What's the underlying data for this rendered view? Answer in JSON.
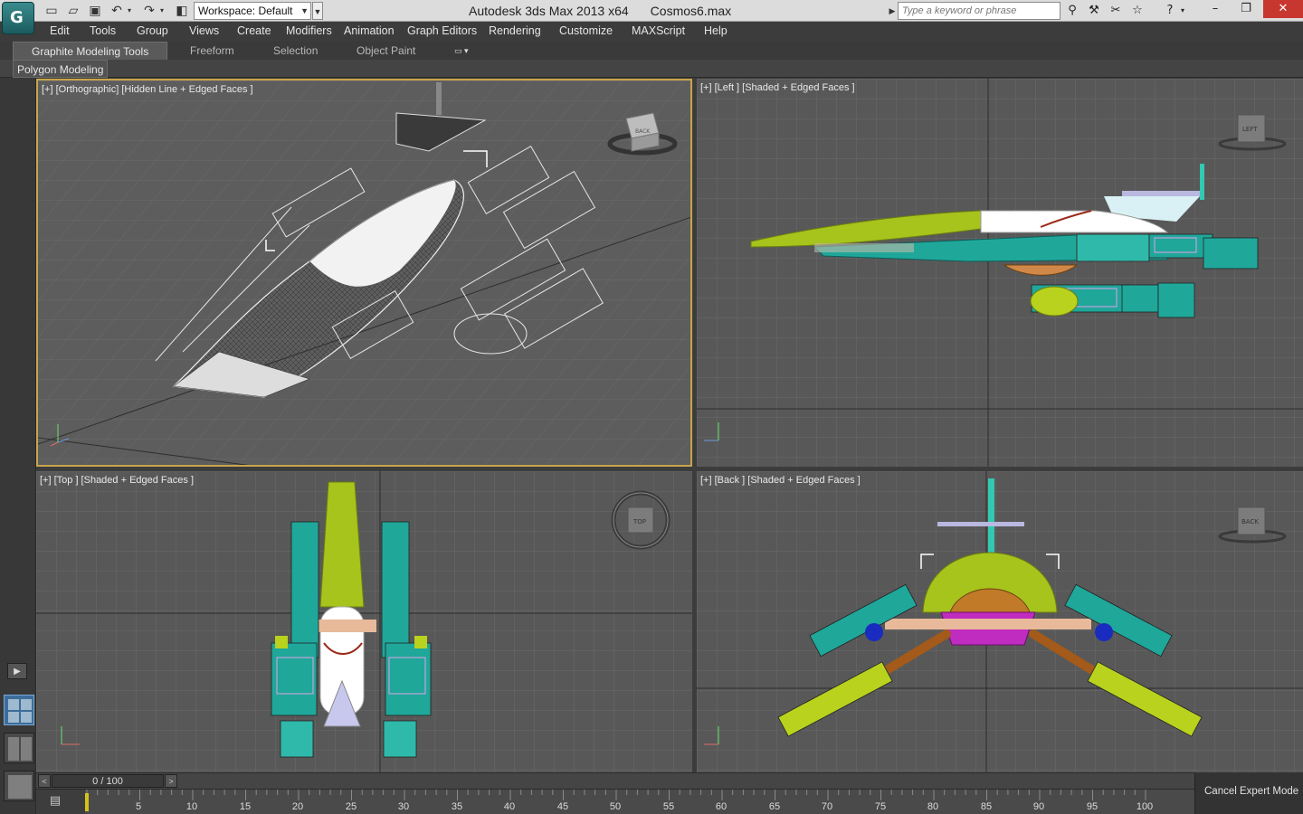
{
  "titlebar": {
    "app_title": "Autodesk 3ds Max  2013 x64",
    "file_name": "Cosmos6.max",
    "workspace_label": "Workspace: Default",
    "search_placeholder": "Type a keyword or phrase"
  },
  "menu": {
    "items": [
      "Edit",
      "Tools",
      "Group",
      "Views",
      "Create",
      "Modifiers",
      "Animation",
      "Graph Editors",
      "Rendering",
      "Customize",
      "MAXScript",
      "Help"
    ]
  },
  "ribbon": {
    "tabs": [
      "Graphite Modeling Tools",
      "Freeform",
      "Selection",
      "Object Paint"
    ],
    "active_panel": "Polygon Modeling"
  },
  "viewports": {
    "perspective": {
      "label": "[+] [Orthographic] [Hidden Line + Edged Faces ]",
      "cube_label": "BACK"
    },
    "left": {
      "label": "[+] [Left ] [Shaded + Edged Faces ]",
      "cube_label": "LEFT"
    },
    "top": {
      "label": "[+] [Top ] [Shaded + Edged Faces ]",
      "cube_label": "TOP"
    },
    "back": {
      "label": "[+] [Back ] [Shaded + Edged Faces ]",
      "cube_label": "BACK"
    }
  },
  "timeline": {
    "frame_display": "0 / 100",
    "ticks": [
      "5",
      "10",
      "15",
      "20",
      "25",
      "30",
      "35",
      "40",
      "45",
      "50",
      "55",
      "60",
      "65",
      "70",
      "75",
      "80",
      "85",
      "90",
      "95",
      "100"
    ]
  },
  "status": {
    "expert_mode_button": "Cancel Expert Mode"
  },
  "colors": {
    "ship_lime": "#a6c41c",
    "ship_teal": "#1fa79a",
    "ship_magenta": "#c02bc0",
    "active_viewport_border": "#c8a54c"
  }
}
